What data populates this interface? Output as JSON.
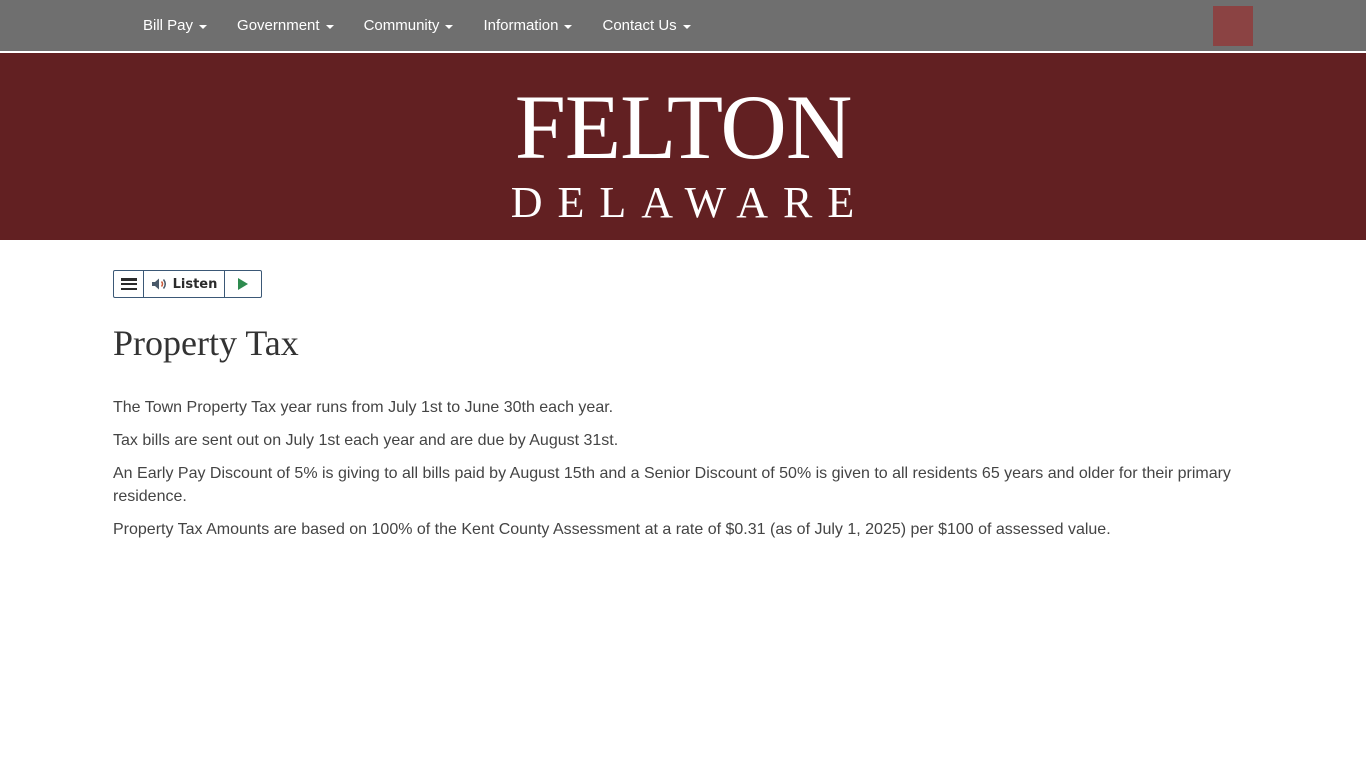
{
  "nav": {
    "items": [
      {
        "label": "Bill Pay"
      },
      {
        "label": "Government"
      },
      {
        "label": "Community"
      },
      {
        "label": "Information"
      },
      {
        "label": "Contact Us"
      }
    ]
  },
  "banner": {
    "logo_line1": "FELTON",
    "logo_line2": "DELAWARE"
  },
  "listen": {
    "label": "Listen"
  },
  "page": {
    "title": "Property Tax",
    "paragraphs": [
      "The Town Property Tax year runs from July 1st to June 30th each year.",
      "Tax bills are sent out on July 1st each year and are due by August 31st.",
      "An Early Pay Discount of 5% is giving to all bills paid by August 15th and a Senior Discount of 50% is given to all residents 65 years and older for their primary residence.",
      "Property Tax Amounts are based on 100% of the Kent County Assessment at a rate of $0.31 (as of July 1, 2025) per $100 of assessed value."
    ]
  },
  "colors": {
    "nav_bg": "#6f6f6f",
    "banner_bg": "#622022",
    "accent_square": "#8b4343",
    "play_green": "#2e8b4f"
  },
  "icons": {
    "menu": "hamburger-icon",
    "speaker": "speaker-icon",
    "play": "play-icon",
    "caret": "caret-down-icon"
  }
}
